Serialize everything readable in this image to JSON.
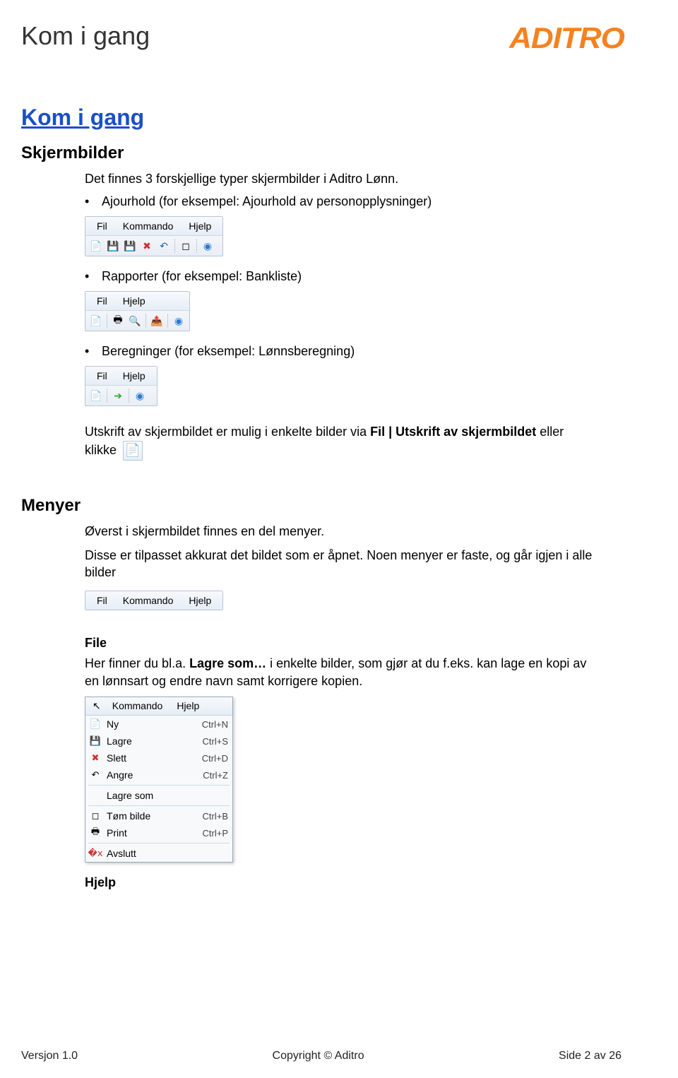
{
  "header": {
    "page_title": "Kom i gang",
    "logo_text": "ADITRO"
  },
  "section": {
    "link_heading": "Kom i gang",
    "skjerm_heading": "Skjermbilder",
    "intro": "Det finnes 3 forskjellige typer skjermbilder i Aditro Lønn.",
    "bullet1": "Ajourhold (for eksempel: Ajourhold av personopplysninger)",
    "bullet2": "Rapporter (for eksempel: Bankliste)",
    "bullet3": "Beregninger (for eksempel: Lønnsberegning)",
    "utskrift_text_a": "Utskrift av skjermbildet er mulig i enkelte bilder via ",
    "utskrift_bold1": "Fil | Utskrift av skjermbildet",
    "utskrift_text_b": " eller klikke "
  },
  "toolbars": {
    "tb1_menu": [
      "Fil",
      "Kommando",
      "Hjelp"
    ],
    "tb2_menu": [
      "Fil",
      "Hjelp"
    ],
    "tb3_menu": [
      "Fil",
      "Hjelp"
    ]
  },
  "menyer": {
    "heading": "Menyer",
    "p1": "Øverst i skjermbildet finnes en del menyer.",
    "p2": "Disse er tilpasset akkurat det bildet som er åpnet. Noen menyer er faste, og går igjen i alle bilder",
    "menubar": [
      "Fil",
      "Kommando",
      "Hjelp"
    ],
    "file_heading": "File",
    "file_para_a": "Her finner du bl.a. ",
    "file_para_bold": "Lagre som…",
    "file_para_b": " i enkelte bilder, som gjør at du f.eks. kan lage en kopi av en lønnsart og endre navn samt korrigere kopien.",
    "popup_top": [
      "Kommando",
      "Hjelp"
    ],
    "popup_items": [
      {
        "icon": "📄",
        "label": "Ny",
        "shortcut": "Ctrl+N"
      },
      {
        "icon": "💾",
        "label": "Lagre",
        "shortcut": "Ctrl+S"
      },
      {
        "icon": "✖",
        "label": "Slett",
        "shortcut": "Ctrl+D"
      },
      {
        "icon": "↶",
        "label": "Angre",
        "shortcut": "Ctrl+Z"
      },
      {
        "divider": true
      },
      {
        "icon": "",
        "label": "Lagre som",
        "shortcut": ""
      },
      {
        "divider": true
      },
      {
        "icon": "◻",
        "label": "Tøm bilde",
        "shortcut": "Ctrl+B"
      },
      {
        "icon": "🖶",
        "label": "Print",
        "shortcut": "Ctrl+P"
      },
      {
        "divider": true
      },
      {
        "icon": "�ⅹ",
        "label": "Avslutt",
        "shortcut": ""
      }
    ],
    "hjelp_heading": "Hjelp"
  },
  "footer": {
    "left": "Versjon 1.0",
    "center": "Copyright © Aditro",
    "right": "Side 2 av 26"
  }
}
